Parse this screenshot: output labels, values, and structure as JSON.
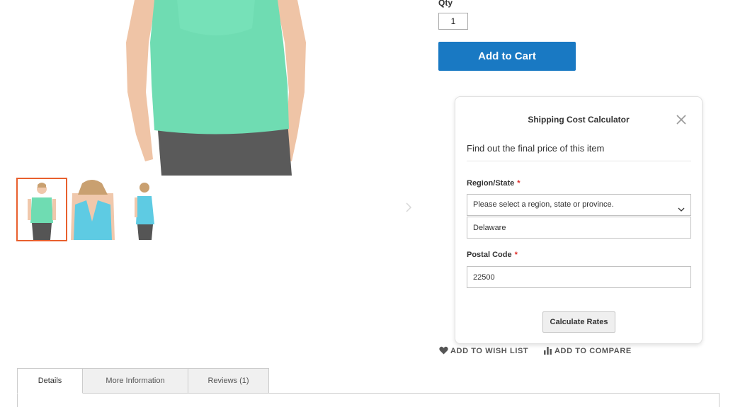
{
  "product": {
    "qty_label": "Qty",
    "qty_value": "1",
    "add_to_cart_label": "Add to Cart",
    "wishlist_label": "ADD TO WISH LIST",
    "compare_label": "ADD TO COMPARE"
  },
  "gallery": {
    "thumbnails": [
      "front-view",
      "back-view",
      "side-view"
    ],
    "active_index": 0,
    "colors": {
      "shirt": "#6fdcb2",
      "shirt_blue": "#5ecbe3",
      "skin": "#f0c8ac",
      "pants": "#555555",
      "active_border": "#e8602e"
    }
  },
  "shipping_calculator": {
    "title": "Shipping Cost Calculator",
    "subtitle": "Find out the final price of this item",
    "region_label": "Region/State",
    "region_placeholder": "Please select a region, state or province.",
    "region_value": "Delaware",
    "postal_label": "Postal Code",
    "postal_value": "22500",
    "required_mark": "*",
    "calculate_label": "Calculate Rates"
  },
  "tabs": [
    {
      "label": "Details",
      "active": true
    },
    {
      "label": "More Information",
      "active": false
    },
    {
      "label": "Reviews (1)",
      "active": false
    }
  ],
  "colors": {
    "primary": "#1979c3",
    "required": "#e02b27"
  }
}
